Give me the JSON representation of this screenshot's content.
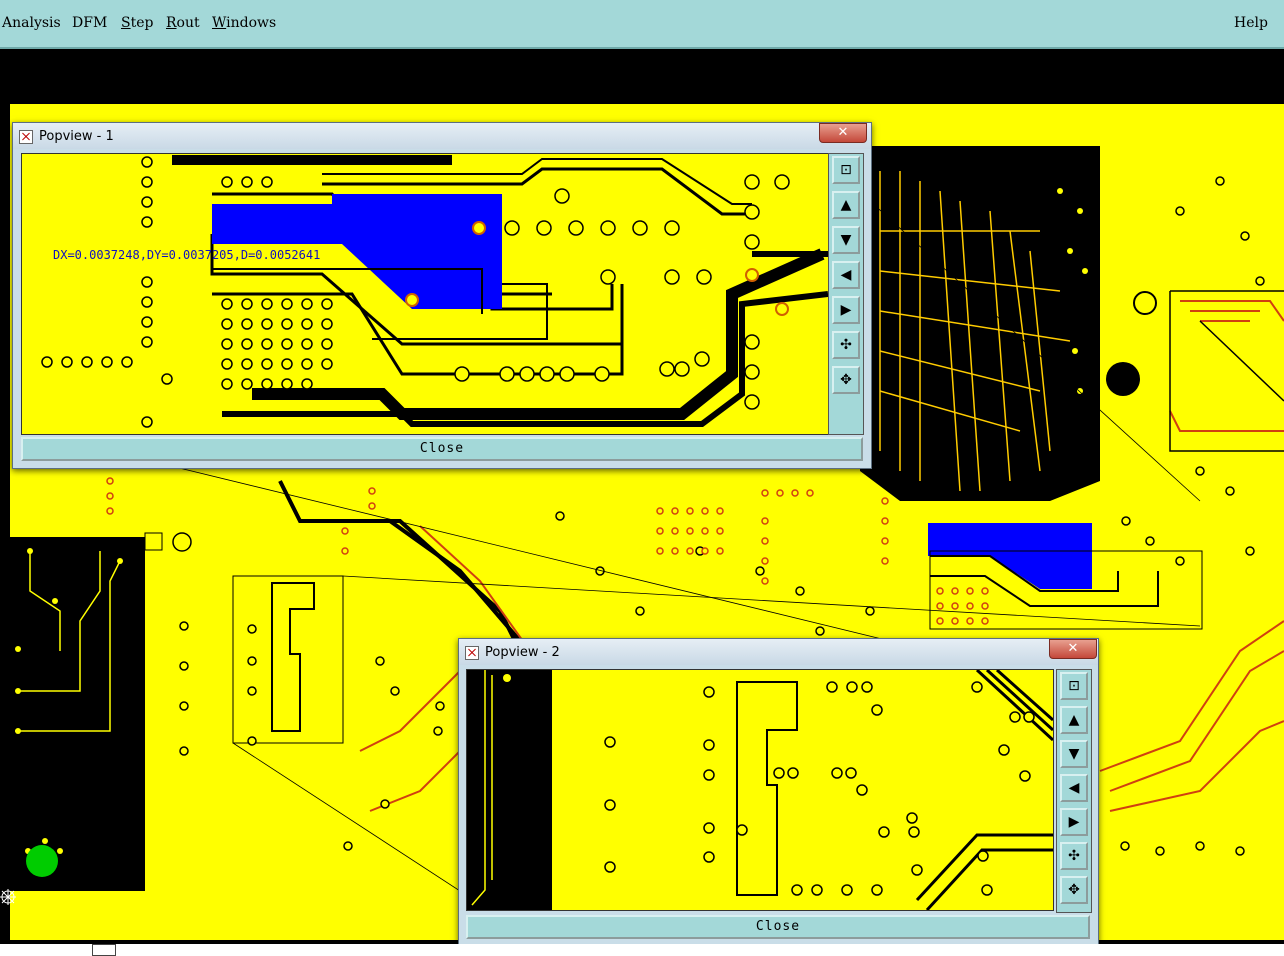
{
  "menubar": {
    "items": [
      "Analysis",
      "DFM",
      "Step",
      "Rout",
      "Windows"
    ],
    "help": "Help"
  },
  "popview1": {
    "title": "Popview - 1",
    "close_label": "Close",
    "measurement": "DX=0.0037248,DY=0.0037205,D=0.0052641"
  },
  "popview2": {
    "title": "Popview - 2",
    "close_label": "Close"
  },
  "toolbar_icons": [
    "zoom-fit-icon",
    "pan-up-icon",
    "pan-down-icon",
    "pan-left-icon",
    "pan-right-icon",
    "zoom-in-icon",
    "zoom-out-icon"
  ],
  "colors": {
    "board": "#ffff00",
    "background": "#000000",
    "highlight": "#0000ff",
    "ui_accent": "#a3d8d8",
    "pad_marker": "#00cc00"
  }
}
